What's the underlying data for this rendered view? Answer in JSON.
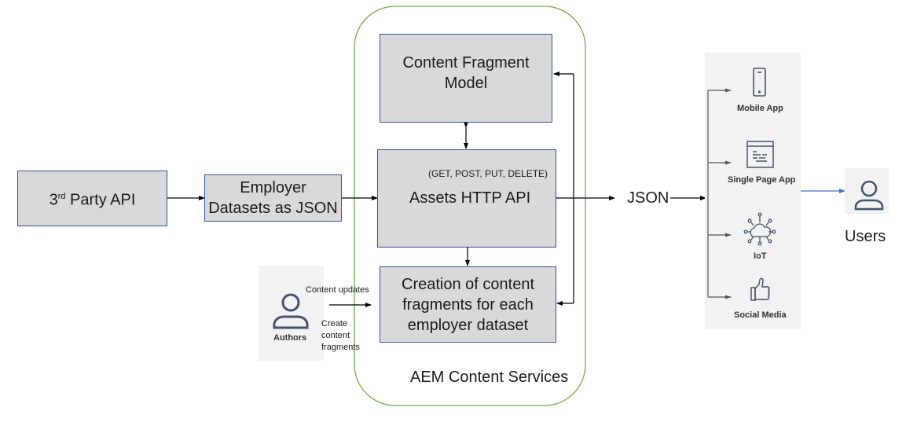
{
  "diagram": {
    "container": {
      "label": "AEM Content Services",
      "border_color": "#70ad47"
    },
    "nodes": {
      "third_party_api": {
        "label_main": "3",
        "label_sup": "rd",
        "label_rest": " Party API"
      },
      "employer_datasets": {
        "line1": "Employer",
        "line2": "Datasets as JSON"
      },
      "content_fragment_model": {
        "line1": "Content Fragment",
        "line2": "Model"
      },
      "assets_http_api": {
        "methods": "(GET, POST, PUT, DELETE)",
        "label": "Assets HTTP API"
      },
      "creation_of_fragments": {
        "line1": "Creation of content",
        "line2": "fragments for each",
        "line3": "employer dataset"
      },
      "json_output": {
        "label": "JSON"
      },
      "authors": {
        "label": "Authors",
        "icon": "person-icon"
      },
      "users": {
        "label": "Users",
        "icon": "person-icon"
      }
    },
    "author_annotations": {
      "content_updates": "Content updates",
      "create_line1": "Create",
      "create_line2": "content",
      "create_line3": "fragments"
    },
    "channels": [
      {
        "label": "Mobile App",
        "icon": "mobile-phone-icon"
      },
      {
        "label": "Single Page App",
        "icon": "browser-window-icon"
      },
      {
        "label": "IoT",
        "icon": "cloud-network-icon"
      },
      {
        "label": "Social Media",
        "icon": "thumbs-up-icon"
      }
    ],
    "colors": {
      "box_fill": "#d9d9d9",
      "box_border": "#2f5597",
      "panel_fill": "#f2f2f2",
      "connector": "#000000",
      "users_connector": "#4472c4"
    }
  }
}
